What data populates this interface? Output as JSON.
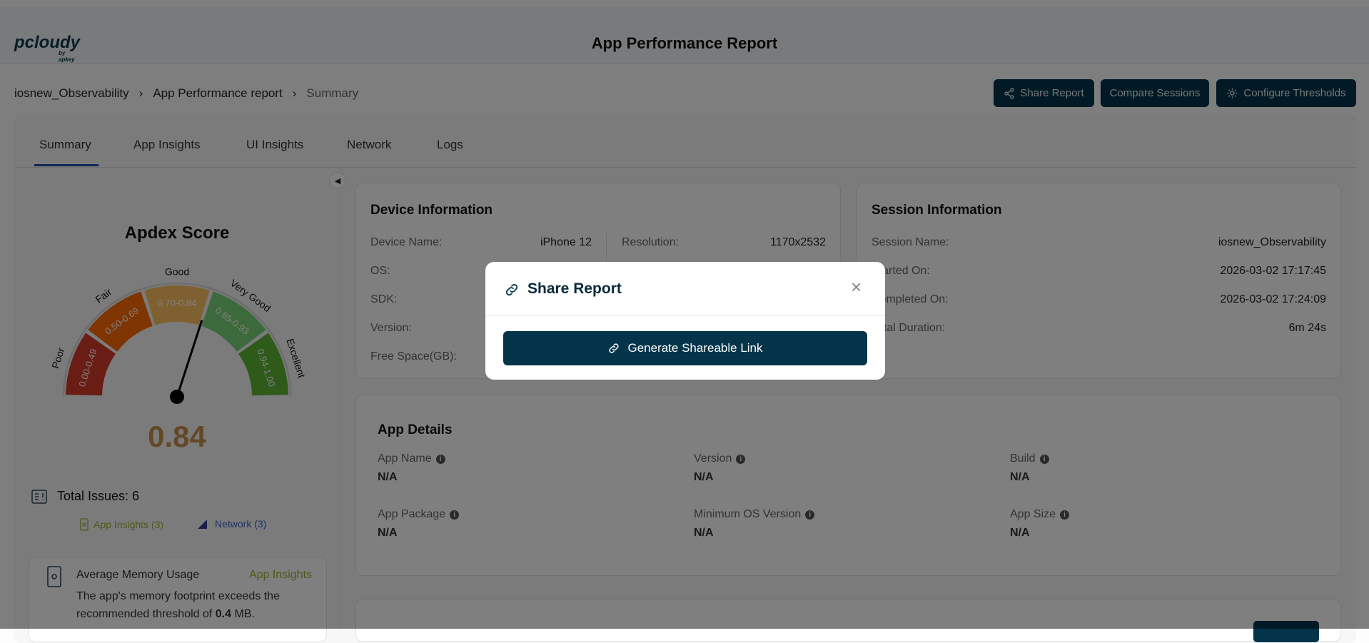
{
  "header": {
    "logo_text": "pcloudy",
    "logo_sub": "by apkey",
    "title": "App Performance Report"
  },
  "breadcrumb": [
    "iosnew_Observability",
    "App Performance report",
    "Summary"
  ],
  "actions": {
    "share": "Share Report",
    "compare": "Compare Sessions",
    "configure": "Configure Thresholds"
  },
  "tabs": [
    "Summary",
    "App Insights",
    "UI Insights",
    "Network",
    "Logs"
  ],
  "active_tab": "Summary",
  "apdex": {
    "title": "Apdex Score",
    "value": 0.84,
    "value_text": "0.84",
    "score_color": "#c8904c",
    "segments": [
      {
        "name": "Poor",
        "range": "0.00-0.49",
        "min": 0,
        "max": 0.49,
        "color": "#d33a2a"
      },
      {
        "name": "Fair",
        "range": "0.50-0.69",
        "min": 0.5,
        "max": 0.69,
        "color": "#fd6a02"
      },
      {
        "name": "Good",
        "range": "0.70-0.84",
        "min": 0.7,
        "max": 0.84,
        "color": "#ffc060"
      },
      {
        "name": "Very Good",
        "range": "0.85-0.93",
        "min": 0.85,
        "max": 0.93,
        "color": "#78d478"
      },
      {
        "name": "Excellent",
        "range": "0.94-1.00",
        "min": 0.94,
        "max": 1.0,
        "color": "#5cb434"
      }
    ]
  },
  "issues": {
    "total": "Total Issues: 6",
    "app_insights": "App Insights (3)",
    "network": "Network (3)",
    "cards": [
      {
        "title": "Average Memory Usage",
        "category": "App Insights",
        "text_before": "The app's memory footprint exceeds the recommended threshold of ",
        "bold": "0.4",
        "text_after": " MB."
      }
    ]
  },
  "device": {
    "title": "Device Information",
    "left": [
      {
        "label": "Device Name:",
        "value": "iPhone 12"
      },
      {
        "label": "OS:",
        "value": ""
      },
      {
        "label": "SDK:",
        "value": ""
      },
      {
        "label": "Version:",
        "value": ""
      },
      {
        "label": "Free Space(GB):",
        "value": ""
      }
    ],
    "right": [
      {
        "label": "Resolution:",
        "value": "1170x2532"
      }
    ]
  },
  "session": {
    "title": "Session Information",
    "rows": [
      {
        "label": "Session Name:",
        "value": "iosnew_Observability"
      },
      {
        "label": "Started On:",
        "value": "2026-03-02 17:17:45"
      },
      {
        "label": "Completed On:",
        "value": "2026-03-02 17:24:09"
      },
      {
        "label": "Total Duration:",
        "value": "6m 24s"
      }
    ]
  },
  "app_details": {
    "title": "App Details",
    "items": [
      {
        "label": "App Name",
        "value": "N/A"
      },
      {
        "label": "Version",
        "value": "N/A"
      },
      {
        "label": "Build",
        "value": "N/A"
      },
      {
        "label": "App Package",
        "value": "N/A"
      },
      {
        "label": "Minimum OS Version",
        "value": "N/A"
      },
      {
        "label": "App Size",
        "value": "N/A"
      }
    ]
  },
  "modal": {
    "title": "Share Report",
    "generate": "Generate Shareable Link"
  },
  "colors": {
    "primary": "#04344a",
    "tab_active": "#1f4fa8",
    "app_insights": "#9bb52a",
    "network": "#3a64c8"
  }
}
